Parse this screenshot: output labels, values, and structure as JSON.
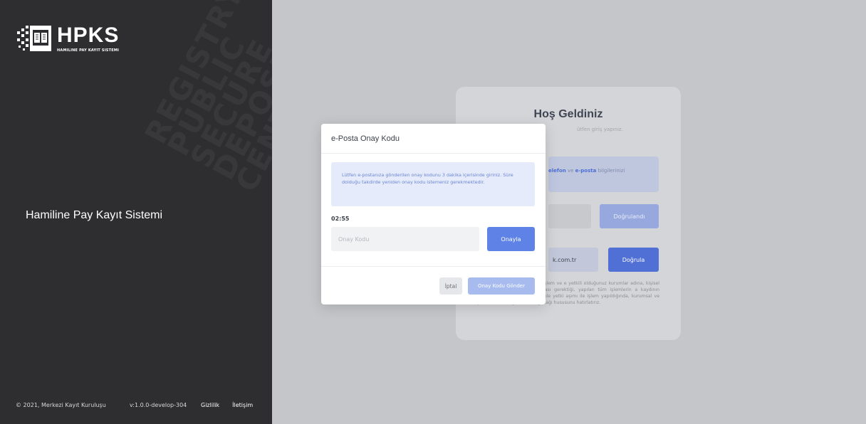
{
  "brand": {
    "logo_title": "HPKS",
    "logo_subtitle": "HAMILINE PAY KAYIT SISTEMI",
    "app_name": "Hamiline Pay Kayıt Sistemi",
    "watermark_words": [
      "REGISTRY",
      "PUBLIC",
      "SECURE",
      "DEPOSIT",
      "CENTER"
    ]
  },
  "footer": {
    "copyright": "© 2021, Merkezi Kayıt Kuruluşu",
    "version": "v:1.0.0-develop-304",
    "privacy": "Gizlilik",
    "contact": "İletişim"
  },
  "login_card": {
    "title": "Hoş Geldiniz",
    "subtitle": "ütfen giriş yapınız.",
    "info_prefix": "elefon",
    "info_mid": " ve ",
    "info_bold2": "e-posta",
    "info_suffix": " bilgilerinizi",
    "verified_button": "Doğrulandı",
    "email_value": "k.com.tr",
    "verify_button": "Doğrula",
    "legal_text": "stemi'nde gerçekleştirdiğiniz işlem ve e yetkili olduğunuz kurumlar adına, kişisel nzuata uygun olarak yapılması gerektiği, yapılan tüm işlemlerin a kaydının saklandığı, herhangi bir nedenle yetki aşımı ile işlem yapıldığında, kurumsal ve şahsi sorumluluğunuzun doğacağı hususunu hatırlatırız."
  },
  "modal": {
    "title": "e-Posta Onay Kodu",
    "alert": "Lütfen e-postanıza gönderilen onay kodunu 3 dakika içerisinde giriniz. Süre dolduğu takdirde yeniden onay kodu istemeniz gerekmektedir.",
    "timer": "02:55",
    "code_placeholder": "Onay Kodu",
    "confirm_button": "Onayla",
    "cancel_button": "İptal",
    "send_code_button": "Onay Kodu Gönder"
  },
  "colors": {
    "primary": "#5e82e6",
    "sidebar_bg": "#2e2e30",
    "page_bg": "#c4c6c9"
  }
}
